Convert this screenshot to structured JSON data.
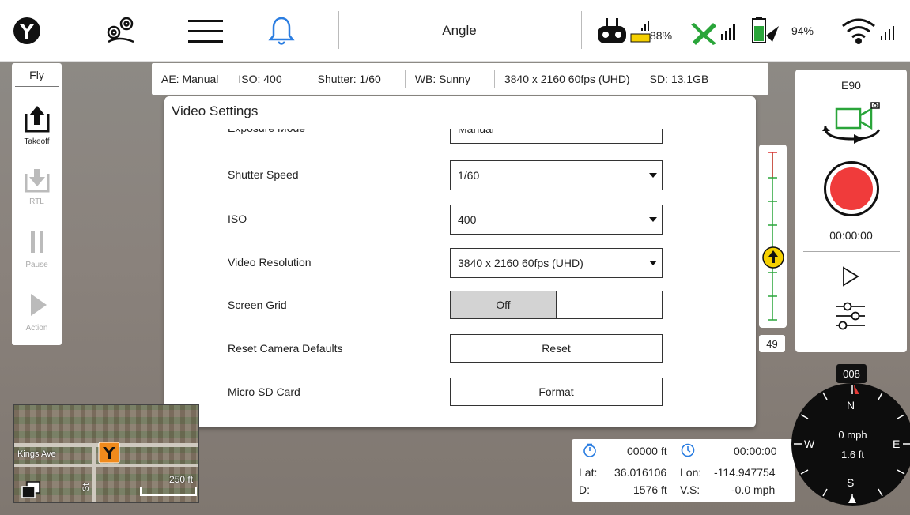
{
  "topbar": {
    "title": "Angle",
    "controller_battery": "88%",
    "drone_battery": "94%",
    "icons": [
      "logo-icon",
      "route-pin-icon",
      "menu-icon",
      "bell-icon",
      "controller-icon",
      "gps-satellite-icon",
      "battery-icon",
      "wifi-icon"
    ]
  },
  "flypanel": {
    "header": "Fly",
    "takeoff": "Takeoff",
    "rtl": "RTL",
    "pause": "Pause",
    "action": "Action"
  },
  "infostrip": {
    "ae": "AE:  Manual",
    "iso": "ISO:  400",
    "shutter": "Shutter:  1/60",
    "wb": "WB:  Sunny",
    "resolution": "3840 x 2160 60fps (UHD)",
    "sd": "SD:  13.1GB"
  },
  "dialog": {
    "title": "Video Settings",
    "partial_row": {
      "label": "Exposure Mode",
      "value": "Manual"
    },
    "rows": [
      {
        "label": "Shutter Speed",
        "value": "1/60"
      },
      {
        "label": "ISO",
        "value": "400"
      },
      {
        "label": "Video Resolution",
        "value": "3840 x 2160 60fps (UHD)"
      }
    ],
    "screen_grid": {
      "label": "Screen Grid",
      "value": "Off"
    },
    "reset": {
      "label": "Reset Camera Defaults",
      "button": "Reset"
    },
    "sd_card": {
      "label": "Micro SD Card",
      "button": "Format"
    }
  },
  "altitude": {
    "value": "49"
  },
  "camera": {
    "model": "E90",
    "timer": "00:00:00"
  },
  "telemetry": {
    "distance_ft": "00000 ft",
    "flight_time": "00:00:00",
    "lat_label": "Lat:",
    "lat": "36.016106",
    "lon_label": "Lon:",
    "lon": "-114.947754",
    "d_label": "D:",
    "d": "1576 ft",
    "vs_label": "V.S:",
    "vs": "-0.0 mph"
  },
  "compass": {
    "heading": "008",
    "n": "N",
    "s": "S",
    "e": "E",
    "w": "W",
    "speed": "0 mph",
    "altitude": "1.6 ft"
  },
  "minimap": {
    "street": "Kings Ave",
    "scale": "250 ft",
    "street2": "St"
  },
  "colors": {
    "record": "#f03b3b",
    "takeoff_accent": "#111111",
    "altitude_marker": "#f5d000",
    "battery_green": "#2aa53a"
  }
}
